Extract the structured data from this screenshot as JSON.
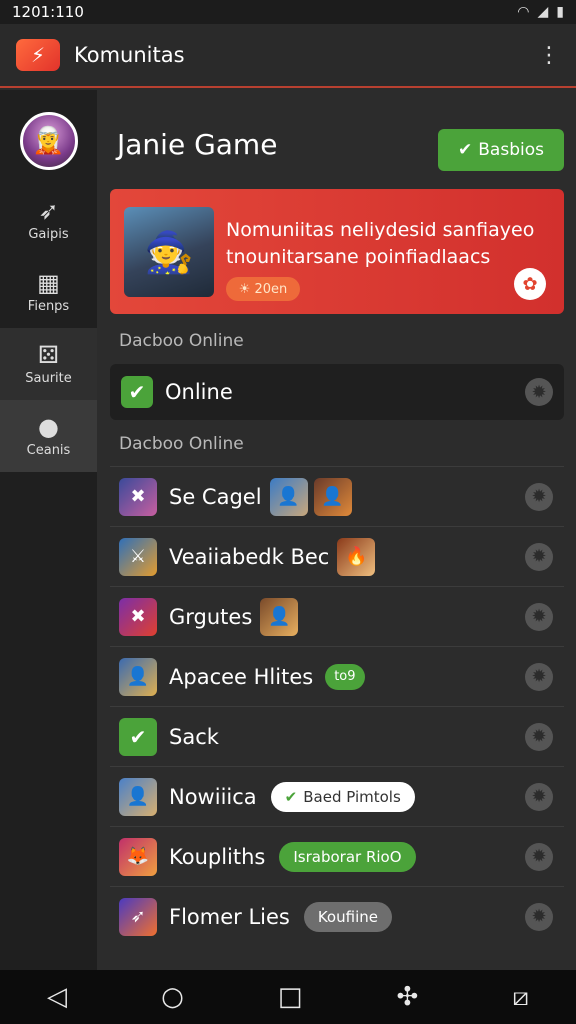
{
  "status_bar": {
    "time": "1201:110",
    "wifi_icon": "wifi-icon",
    "signal_icon": "signal-icon",
    "battery_icon": "battery-icon"
  },
  "app_bar": {
    "title": "Komunitas",
    "logo_icon": "community-logo-icon",
    "menu_icon": "more-vert-icon"
  },
  "sidebar": {
    "items": [
      {
        "label": "Gaipis",
        "icon": "bird-icon"
      },
      {
        "label": "Fienps",
        "icon": "grid-icon"
      },
      {
        "label": "Saurite",
        "icon": "dice-icon"
      },
      {
        "label": "Ceanis",
        "icon": "dots-icon"
      }
    ]
  },
  "main": {
    "game_title": "Janie Game",
    "status_button": "Basbios",
    "banner": {
      "text": "Nomuniitas neliydesid sanfiayeo tnounitarsane poinfiadlaacs",
      "pill": "20en"
    },
    "section1_label": "Dacboo Online",
    "online_row": {
      "label": "Online"
    },
    "section2_label": "Dacboo Online",
    "list": [
      {
        "label": "Se Cagel",
        "tag": ""
      },
      {
        "label": "Veaiiabedk Bec",
        "tag": ""
      },
      {
        "label": "Grgutes",
        "tag": ""
      },
      {
        "label": "Apacee Hlites",
        "tag": "to9"
      },
      {
        "label": "Sack",
        "tag": ""
      },
      {
        "label": "Nowiiica",
        "tag": "Baed Pimtols"
      },
      {
        "label": "Koupliths",
        "tag": "Israborar RioO"
      },
      {
        "label": "Flomer Lies",
        "tag": "Koufiine"
      }
    ]
  },
  "colors": {
    "accent": "#e2442f",
    "green": "#4ba33a",
    "bg": "#2c2c2c"
  }
}
